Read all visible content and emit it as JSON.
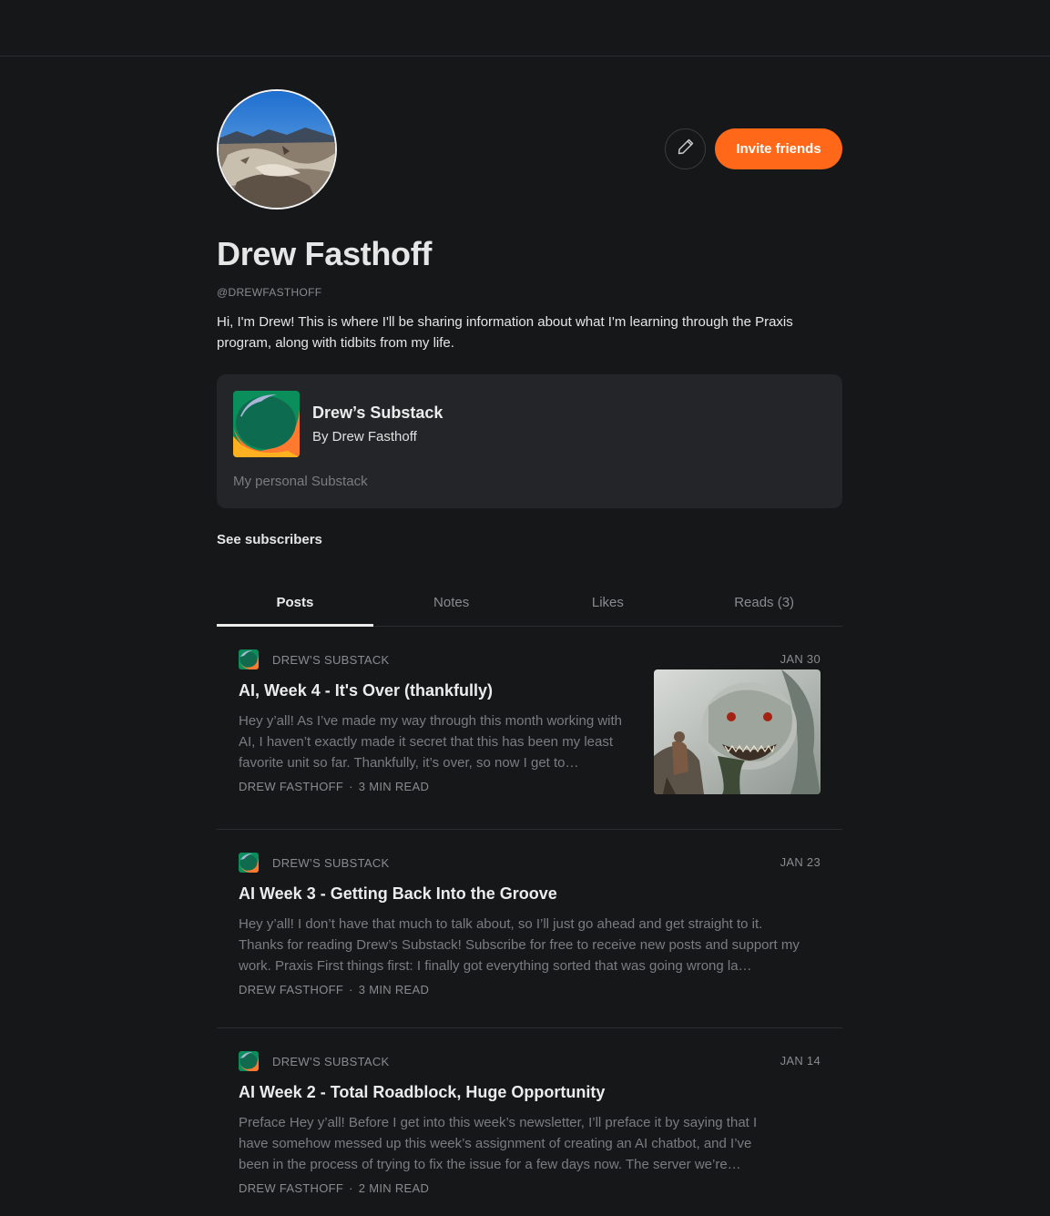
{
  "profile": {
    "name": "Drew Fasthoff",
    "handle": "@DREWFASTHOFF",
    "bio": "Hi, I'm Drew! This is where I'll be sharing information about what I'm learning through the Praxis program, along with tidbits from my life.",
    "invite_label": "Invite friends",
    "see_subscribers_label": "See subscribers"
  },
  "publication": {
    "title": "Drew’s Substack",
    "by": "By Drew Fasthoff",
    "description": "My personal Substack"
  },
  "tabs": [
    {
      "label": "Posts",
      "active": true
    },
    {
      "label": "Notes",
      "active": false
    },
    {
      "label": "Likes",
      "active": false
    },
    {
      "label": "Reads (3)",
      "active": false
    }
  ],
  "posts": [
    {
      "publication": "DREW’S SUBSTACK",
      "date": "JAN 30",
      "title": "AI, Week 4 - It's Over (thankfully)",
      "excerpt": "Hey y’all! As I’ve made my way through this month working with AI, I haven’t exactly made it secret that this has been my least favorite unit so far. Thankfully, it’s over, so now I get to…",
      "author": "DREW FASTHOFF",
      "read_time": "3 MIN READ"
    },
    {
      "publication": "DREW’S SUBSTACK",
      "date": "JAN 23",
      "title": "AI Week 3 - Getting Back Into the Groove",
      "excerpt": "Hey y’all! I don’t have that much to talk about, so I’ll just go ahead and get straight to it. Thanks for reading Drew’s Substack! Subscribe for free to receive new posts and support my work. Praxis First things first: I finally got everything sorted that was going wrong la…",
      "author": "DREW FASTHOFF",
      "read_time": "3 MIN READ"
    },
    {
      "publication": "DREW’S SUBSTACK",
      "date": "JAN 14",
      "title": "AI Week 2 - Total Roadblock, Huge Opportunity",
      "excerpt": "Preface Hey y’all! Before I get into this week’s newsletter, I’ll preface it by saying that I have somehow messed up this week’s assignment of creating an AI chatbot, and I’ve been in the process of trying to fix the issue for a few days now. The server we’re…",
      "author": "DREW FASTHOFF",
      "read_time": "2 MIN READ"
    }
  ],
  "byline_separator": "·",
  "icons": {
    "edit": "pencil-icon",
    "publication_logo": "substack-logo-icon"
  },
  "colors": {
    "accent": "#ff6719",
    "background": "#161719",
    "card": "#242528"
  }
}
